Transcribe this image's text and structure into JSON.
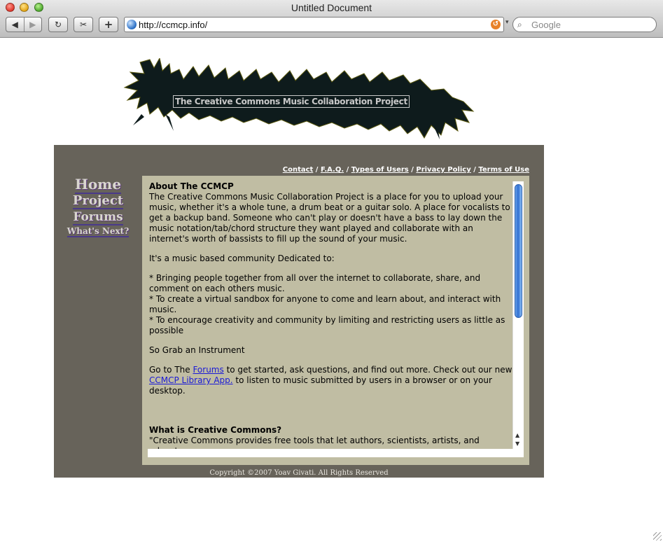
{
  "window": {
    "title": "Untitled Document"
  },
  "toolbar": {
    "back_icon": "◀",
    "forward_icon": "▶",
    "reload_icon": "↻",
    "snip_icon": "✂",
    "add_icon": "+",
    "url": "http://ccmcp.info/",
    "rss_icon": "↺",
    "search_placeholder": "Google",
    "search_icon": "⌕"
  },
  "banner": {
    "title": "The Creative Commons Music Collaboration Project"
  },
  "toplinks": [
    {
      "label": "Contact"
    },
    {
      "label": "F.A.Q."
    },
    {
      "label": "Types of Users"
    },
    {
      "label": "Privacy Policy"
    },
    {
      "label": "Terms of Use"
    }
  ],
  "separator": " / ",
  "sidenav": {
    "home": "Home",
    "project": "Project",
    "forums": "Forums",
    "whats_next": "What's Next?"
  },
  "content": {
    "about_heading": "About The CCMCP",
    "about_text": "The Creative Commons Music Collaboration Project is a place for you to upload your music, whether it's a whole tune, a drum beat or a guitar solo. A place for vocalists to get a backup band. Someone who can't play or doesn't have a bass to lay down the music notation/tab/chord structure they want played and collaborate with an internet's worth of bassists to fill up the sound of your music.",
    "community_intro": "It's a music based community Dedicated to:",
    "bullet_1": "* Bringing people together from all over the internet to collaborate, share, and comment on each others music.",
    "bullet_2": "* To create a virtual sandbox for anyone to come and learn about, and interact with music.",
    "bullet_3": "* To encourage creativity and community by limiting and restricting users as little as possible",
    "grab_instrument": "So Grab an Instrument",
    "goto_prefix": "Go to The ",
    "forums_link": "Forums",
    "goto_middle": " to get started, ask questions, and find out more. Check out our new ",
    "library_link": "CCMCP Library App.",
    "goto_suffix": " to listen to music submitted by users in a browser or on your desktop.",
    "cc_heading": "What is Creative Commons?",
    "cc_text": "\"Creative Commons provides free tools that let authors, scientists, artists, and educators"
  },
  "footer": {
    "copyright": "Copyright ©2007 Yoav Givati. All Rights Reserved"
  },
  "colors": {
    "main_bg": "#67635a",
    "content_bg": "#c0bda3",
    "banner_fill": "#0e1b1c"
  }
}
